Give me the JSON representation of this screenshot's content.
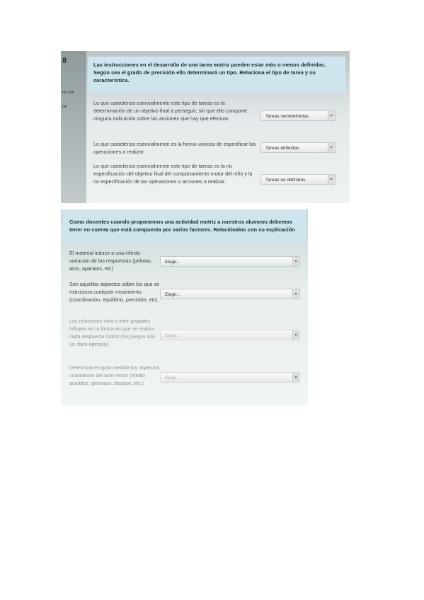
{
  "photo1": {
    "question_number": "8",
    "grade_label": "no 1,00",
    "flag_label": "car",
    "question": "Las instrucciones en el desarrollo de una tarea motriz pueden estar más o menos definidas. Según sea el grado de precisión ello determinará un tipo. Relaciona el tipo de tarea y su característica.",
    "rows": [
      {
        "text": "Lo que caracteriza esencialmente este tipo de tareas es la determinación de un objetivo final a perseguir, sin que ello comporte ninguna indicación sobre las acciones que hay que efectuar.",
        "answer": "Tareas semidefinidas"
      },
      {
        "text": "Lo que caracteriza esencialmente es la forma univoca de especificar las operaciones a realizar.",
        "answer": "Tareas definidas"
      },
      {
        "text": "Lo que caracteriza esencialmente este tipo de tareas es la no especificación del objetivo final del comportamiento motor del niño y la no especificación de las operaciones o acciones a realizar.",
        "answer": "Tareas no definidas"
      }
    ]
  },
  "photo2": {
    "question": "Como docentes cuando proponemos una actividad motriz a nuestros alumnos debemos tener en cuenta que está compuesta por varios factores. Relaciónalos con su explicación",
    "rows": [
      {
        "text": "El material induce a una infinita variación de las respuestas (pelotas, aros, aparatos, etc)",
        "answer": "Elegir..."
      },
      {
        "text": "Son aquellos aspectos sobre los que se estructura cualquier movimiento (coordinación, equilibrio, precisión, etc).",
        "answer": "Elegir..."
      },
      {
        "text": "Las relaciones intra e inter-grupales influyen en la forma en que se realiza cada respuesta motriz (los juegos son un claro ejemplo).",
        "answer": "Elegir..."
      },
      {
        "text": "Determina en gran medida los aspectos cualitativos del acto motor (medio acuático, gimnasio, bosque, etc.)",
        "answer": "Elegir..."
      }
    ]
  }
}
